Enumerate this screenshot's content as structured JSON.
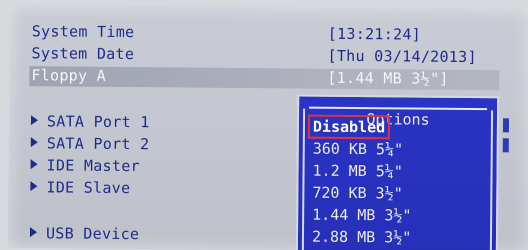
{
  "settings": {
    "system_time": {
      "label": "System Time",
      "value": "[13:21:24]"
    },
    "system_date": {
      "label": "System Date",
      "value": "[Thu 03/14/2013]"
    },
    "floppy_a": {
      "label": "Floppy A",
      "value": "[1.44 MB 3½\"]"
    }
  },
  "submenus": [
    {
      "label": "SATA Port 1"
    },
    {
      "label": "SATA Port 2"
    },
    {
      "label": "IDE Master"
    },
    {
      "label": "IDE Slave"
    },
    {
      "label": "USB  Device"
    }
  ],
  "options_popup": {
    "title": "Options",
    "items": [
      {
        "label": "Disabled"
      },
      {
        "label": "360 KB 5¼\""
      },
      {
        "label": "1.2 MB 5¼\""
      },
      {
        "label": "720 KB 3½\""
      },
      {
        "label": "1.44 MB 3½\""
      },
      {
        "label": "2.88 MB 3½\""
      }
    ],
    "selected_index": 0
  },
  "colors": {
    "bios_text": "#1d2b8a",
    "popup_background": "#2b33c4",
    "selection_outline": "#e0323a"
  }
}
